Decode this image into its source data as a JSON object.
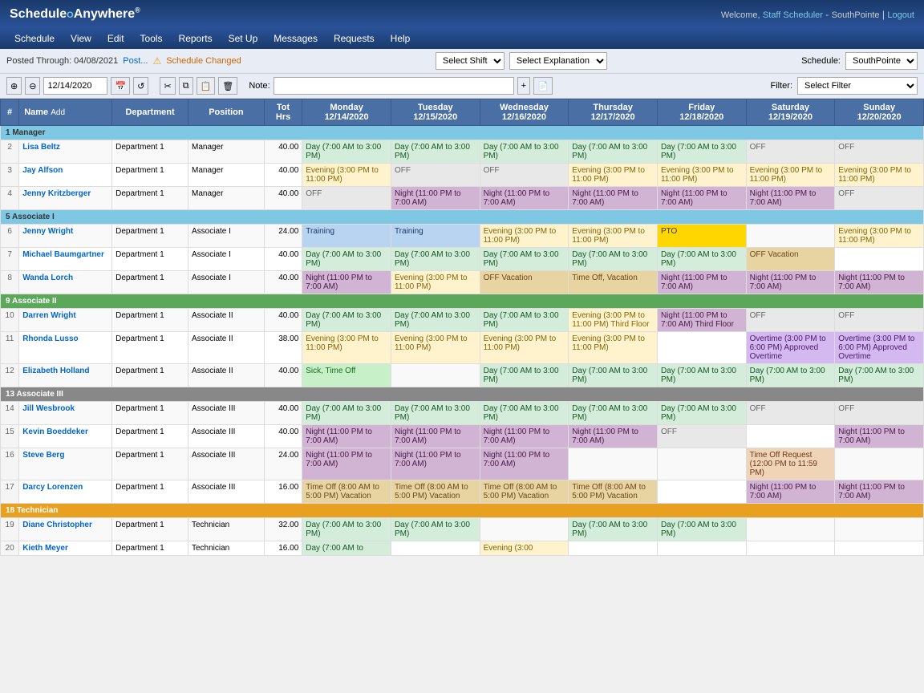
{
  "header": {
    "logo": "ScheduleAnywhere",
    "welcome": "Welcome,",
    "user_link": "Staff Scheduler",
    "org": "SouthPointe",
    "logout": "Logout"
  },
  "nav": {
    "items": [
      "Schedule",
      "View",
      "Edit",
      "Tools",
      "Reports",
      "Set Up",
      "Messages",
      "Requests",
      "Help"
    ]
  },
  "toolbar": {
    "posted_label": "Posted Through: 04/08/2021",
    "post_link": "Post...",
    "schedule_changed": "Schedule Changed",
    "select_shift_placeholder": "Select Shift",
    "select_explanation_placeholder": "Select Explanation",
    "date_value": "12/14/2020",
    "note_label": "Note:",
    "schedule_label": "Schedule:",
    "schedule_value": "SouthPointe",
    "filter_label": "Filter:",
    "filter_placeholder": "Select Filter"
  },
  "table": {
    "headers": {
      "num": "#",
      "name": "Name",
      "add": "Add",
      "dept": "Department",
      "pos": "Position",
      "hrs": "Tot Hrs",
      "mon": "Monday\n12/14/2020",
      "tue": "Tuesday\n12/15/2020",
      "wed": "Wednesday\n12/16/2020",
      "thu": "Thursday\n12/17/2020",
      "fri": "Friday\n12/18/2020",
      "sat": "Saturday\n12/19/2020",
      "sun": "Sunday\n12/20/2020"
    },
    "sections": [
      {
        "id": 1,
        "label": "Manager",
        "type": "manager",
        "rows": [
          {
            "num": 2,
            "name": "Lisa Beltz",
            "dept": "Department 1",
            "pos": "Manager",
            "hrs": "40.00",
            "mon": {
              "text": "Day (7:00 AM to 3:00 PM)",
              "type": "day"
            },
            "tue": {
              "text": "Day (7:00 AM to 3:00 PM)",
              "type": "day"
            },
            "wed": {
              "text": "Day (7:00 AM to 3:00 PM)",
              "type": "day"
            },
            "thu": {
              "text": "Day (7:00 AM to 3:00 PM)",
              "type": "day"
            },
            "fri": {
              "text": "Day (7:00 AM to 3:00 PM)",
              "type": "day"
            },
            "sat": {
              "text": "OFF",
              "type": "off"
            },
            "sun": {
              "text": "OFF",
              "type": "off"
            }
          },
          {
            "num": 3,
            "name": "Jay Alfson",
            "dept": "Department 1",
            "pos": "Manager",
            "hrs": "40.00",
            "mon": {
              "text": "Evening (3:00 PM to 11:00 PM)",
              "type": "evening"
            },
            "tue": {
              "text": "OFF",
              "type": "off"
            },
            "wed": {
              "text": "OFF",
              "type": "off"
            },
            "thu": {
              "text": "Evening (3:00 PM to 11:00 PM)",
              "type": "evening"
            },
            "fri": {
              "text": "Evening (3:00 PM to 11:00 PM)",
              "type": "evening"
            },
            "sat": {
              "text": "Evening (3:00 PM to 11:00 PM)",
              "type": "evening"
            },
            "sun": {
              "text": "Evening (3:00 PM to 11:00 PM)",
              "type": "evening"
            }
          },
          {
            "num": 4,
            "name": "Jenny Kritzberger",
            "dept": "Department 1",
            "pos": "Manager",
            "hrs": "40.00",
            "mon": {
              "text": "OFF",
              "type": "off"
            },
            "tue": {
              "text": "Night (11:00 PM to 7:00 AM)",
              "type": "night"
            },
            "wed": {
              "text": "Night (11:00 PM to 7:00 AM)",
              "type": "night"
            },
            "thu": {
              "text": "Night (11:00 PM to 7:00 AM)",
              "type": "night"
            },
            "fri": {
              "text": "Night (11:00 PM to 7:00 AM)",
              "type": "night"
            },
            "sat": {
              "text": "Night (11:00 PM to 7:00 AM)",
              "type": "night"
            },
            "sun": {
              "text": "OFF",
              "type": "off"
            }
          }
        ]
      },
      {
        "id": 5,
        "label": "Associate I",
        "type": "assoc1",
        "rows": [
          {
            "num": 6,
            "name": "Jenny Wright",
            "dept": "Department 1",
            "pos": "Associate I",
            "hrs": "24.00",
            "mon": {
              "text": "Training",
              "type": "training"
            },
            "tue": {
              "text": "Training",
              "type": "training"
            },
            "wed": {
              "text": "Evening (3:00 PM to 11:00 PM)",
              "type": "evening"
            },
            "thu": {
              "text": "Evening (3:00 PM to 11:00 PM)",
              "type": "evening"
            },
            "fri": {
              "text": "PTO",
              "type": "pto"
            },
            "sat": {
              "text": "",
              "type": ""
            },
            "sun": {
              "text": "Evening (3:00 PM to 11:00 PM)",
              "type": "evening"
            }
          },
          {
            "num": 7,
            "name": "Michael Baumgartner",
            "dept": "Department 1",
            "pos": "Associate I",
            "hrs": "40.00",
            "mon": {
              "text": "Day (7:00 AM to 3:00 PM)",
              "type": "day"
            },
            "tue": {
              "text": "Day (7:00 AM to 3:00 PM)",
              "type": "day"
            },
            "wed": {
              "text": "Day (7:00 AM to 3:00 PM)",
              "type": "day"
            },
            "thu": {
              "text": "Day (7:00 AM to 3:00 PM)",
              "type": "day"
            },
            "fri": {
              "text": "Day (7:00 AM to 3:00 PM)",
              "type": "day"
            },
            "sat": {
              "text": "OFF Vacation",
              "type": "vacation"
            },
            "sun": {
              "text": "",
              "type": ""
            }
          },
          {
            "num": 8,
            "name": "Wanda Lorch",
            "dept": "Department 1",
            "pos": "Associate I",
            "hrs": "40.00",
            "mon": {
              "text": "Night (11:00 PM to 7:00 AM)",
              "type": "night"
            },
            "tue": {
              "text": "Evening (3:00 PM to 11:00 PM)",
              "type": "evening"
            },
            "wed": {
              "text": "OFF Vacation",
              "type": "vacation"
            },
            "thu": {
              "text": "Time Off, Vacation",
              "type": "timeoff"
            },
            "fri": {
              "text": "Night (11:00 PM to 7:00 AM)",
              "type": "night"
            },
            "sat": {
              "text": "Night (11:00 PM to 7:00 AM)",
              "type": "night"
            },
            "sun": {
              "text": "Night (11:00 PM to 7:00 AM)",
              "type": "night"
            }
          }
        ]
      },
      {
        "id": 9,
        "label": "Associate II",
        "type": "assoc2",
        "rows": [
          {
            "num": 10,
            "name": "Darren Wright",
            "dept": "Department 1",
            "pos": "Associate II",
            "hrs": "40.00",
            "mon": {
              "text": "Day (7:00 AM to 3:00 PM)",
              "type": "day"
            },
            "tue": {
              "text": "Day (7:00 AM to 3:00 PM)",
              "type": "day"
            },
            "wed": {
              "text": "Day (7:00 AM to 3:00 PM)",
              "type": "day"
            },
            "thu": {
              "text": "Evening (3:00 PM to 11:00 PM) Third Floor",
              "type": "evening"
            },
            "fri": {
              "text": "Night (11:00 PM to 7:00 AM) Third Floor",
              "type": "night"
            },
            "sat": {
              "text": "OFF",
              "type": "off"
            },
            "sun": {
              "text": "OFF",
              "type": "off"
            }
          },
          {
            "num": 11,
            "name": "Rhonda Lusso",
            "dept": "Department 1",
            "pos": "Associate II",
            "hrs": "38.00",
            "mon": {
              "text": "Evening (3:00 PM to 11:00 PM)",
              "type": "evening"
            },
            "tue": {
              "text": "Evening (3:00 PM to 11:00 PM)",
              "type": "evening"
            },
            "wed": {
              "text": "Evening (3:00 PM to 11:00 PM)",
              "type": "evening"
            },
            "thu": {
              "text": "Evening (3:00 PM to 11:00 PM)",
              "type": "evening"
            },
            "fri": {
              "text": "",
              "type": ""
            },
            "sat": {
              "text": "Overtime (3:00 PM to 6:00 PM) Approved Overtime",
              "type": "overtime"
            },
            "sun": {
              "text": "Overtime (3:00 PM to 6:00 PM) Approved Overtime",
              "type": "overtime"
            }
          },
          {
            "num": 12,
            "name": "Elizabeth Holland",
            "dept": "Department 1",
            "pos": "Associate II",
            "hrs": "40.00",
            "mon": {
              "text": "Sick, Time Off",
              "type": "sick"
            },
            "tue": {
              "text": "",
              "type": ""
            },
            "wed": {
              "text": "Day (7:00 AM to 3:00 PM)",
              "type": "day"
            },
            "thu": {
              "text": "Day (7:00 AM to 3:00 PM)",
              "type": "day"
            },
            "fri": {
              "text": "Day (7:00 AM to 3:00 PM)",
              "type": "day"
            },
            "sat": {
              "text": "Day (7:00 AM to 3:00 PM)",
              "type": "day"
            },
            "sun": {
              "text": "Day (7:00 AM to 3:00 PM)",
              "type": "day"
            }
          }
        ]
      },
      {
        "id": 13,
        "label": "Associate III",
        "type": "assoc3",
        "rows": [
          {
            "num": 14,
            "name": "Jill Wesbrook",
            "dept": "Department 1",
            "pos": "Associate III",
            "hrs": "40.00",
            "mon": {
              "text": "Day (7:00 AM to 3:00 PM)",
              "type": "day"
            },
            "tue": {
              "text": "Day (7:00 AM to 3:00 PM)",
              "type": "day"
            },
            "wed": {
              "text": "Day (7:00 AM to 3:00 PM)",
              "type": "day"
            },
            "thu": {
              "text": "Day (7:00 AM to 3:00 PM)",
              "type": "day"
            },
            "fri": {
              "text": "Day (7:00 AM to 3:00 PM)",
              "type": "day"
            },
            "sat": {
              "text": "OFF",
              "type": "off"
            },
            "sun": {
              "text": "OFF",
              "type": "off"
            }
          },
          {
            "num": 15,
            "name": "Kevin Boeddeker",
            "dept": "Department 1",
            "pos": "Associate III",
            "hrs": "40.00",
            "mon": {
              "text": "Night (11:00 PM to 7:00 AM)",
              "type": "night"
            },
            "tue": {
              "text": "Night (11:00 PM to 7:00 AM)",
              "type": "night"
            },
            "wed": {
              "text": "Night (11:00 PM to 7:00 AM)",
              "type": "night"
            },
            "thu": {
              "text": "Night (11:00 PM to 7:00 AM)",
              "type": "night"
            },
            "fri": {
              "text": "OFF",
              "type": "off"
            },
            "sat": {
              "text": "",
              "type": ""
            },
            "sun": {
              "text": "Night (11:00 PM to 7:00 AM)",
              "type": "night"
            }
          },
          {
            "num": 16,
            "name": "Steve Berg",
            "dept": "Department 1",
            "pos": "Associate III",
            "hrs": "24.00",
            "mon": {
              "text": "Night (11:00 PM to 7:00 AM)",
              "type": "night"
            },
            "tue": {
              "text": "Night (11:00 PM to 7:00 AM)",
              "type": "night"
            },
            "wed": {
              "text": "Night (11:00 PM to 7:00 AM)",
              "type": "night"
            },
            "thu": {
              "text": "",
              "type": ""
            },
            "fri": {
              "text": "",
              "type": ""
            },
            "sat": {
              "text": "Time Off Request (12:00 PM to 11:59 PM)",
              "type": "timereq"
            },
            "sun": {
              "text": "",
              "type": ""
            }
          },
          {
            "num": 17,
            "name": "Darcy Lorenzen",
            "dept": "Department 1",
            "pos": "Associate III",
            "hrs": "16.00",
            "mon": {
              "text": "Time Off (8:00 AM to 5:00 PM) Vacation",
              "type": "vacation"
            },
            "tue": {
              "text": "Time Off (8:00 AM to 5:00 PM) Vacation",
              "type": "vacation"
            },
            "wed": {
              "text": "Time Off (8:00 AM to 5:00 PM) Vacation",
              "type": "vacation"
            },
            "thu": {
              "text": "Time Off (8:00 AM to 5:00 PM) Vacation",
              "type": "vacation"
            },
            "fri": {
              "text": "",
              "type": ""
            },
            "sat": {
              "text": "Night (11:00 PM to 7:00 AM)",
              "type": "night"
            },
            "sun": {
              "text": "Night (11:00 PM to 7:00 AM)",
              "type": "night"
            }
          }
        ]
      },
      {
        "id": 18,
        "label": "Technician",
        "type": "tech",
        "rows": [
          {
            "num": 19,
            "name": "Diane Christopher",
            "dept": "Department 1",
            "pos": "Technician",
            "hrs": "32.00",
            "mon": {
              "text": "Day (7:00 AM to 3:00 PM)",
              "type": "day"
            },
            "tue": {
              "text": "Day (7:00 AM to 3:00 PM)",
              "type": "day"
            },
            "wed": {
              "text": "",
              "type": ""
            },
            "thu": {
              "text": "Day (7:00 AM to 3:00 PM)",
              "type": "day"
            },
            "fri": {
              "text": "Day (7:00 AM to 3:00 PM)",
              "type": "day"
            },
            "sat": {
              "text": "",
              "type": ""
            },
            "sun": {
              "text": "",
              "type": ""
            }
          },
          {
            "num": 20,
            "name": "Kieth Meyer",
            "dept": "Department 1",
            "pos": "Technician",
            "hrs": "16.00",
            "mon": {
              "text": "Day (7:00 AM to",
              "type": "day"
            },
            "tue": {
              "text": "",
              "type": ""
            },
            "wed": {
              "text": "Evening (3:00",
              "type": "evening"
            },
            "thu": {
              "text": "",
              "type": ""
            },
            "fri": {
              "text": "",
              "type": ""
            },
            "sat": {
              "text": "",
              "type": ""
            },
            "sun": {
              "text": "",
              "type": ""
            }
          }
        ]
      }
    ]
  }
}
